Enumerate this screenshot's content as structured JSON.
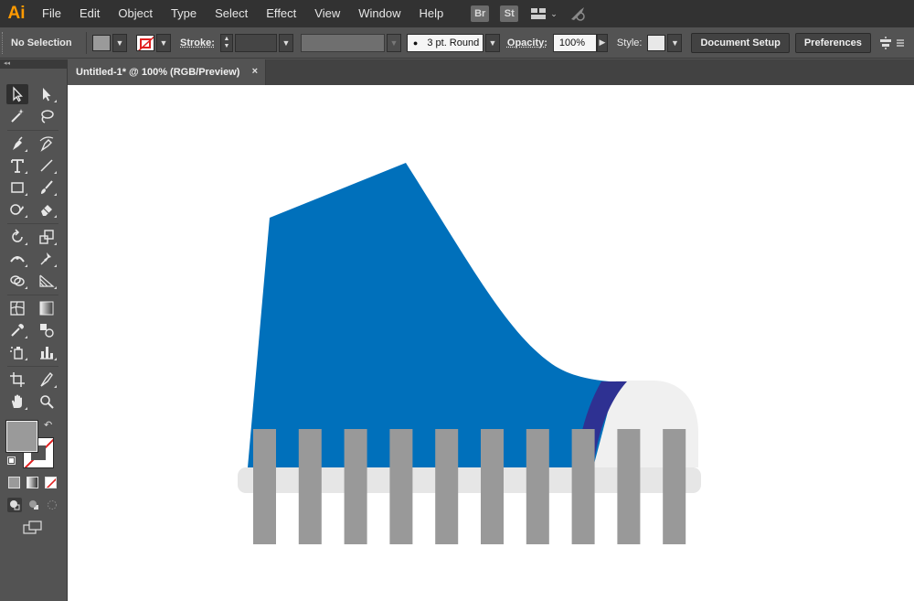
{
  "app": {
    "logo": "Ai",
    "accent": "#ff9a00"
  },
  "menu": [
    "File",
    "Edit",
    "Object",
    "Type",
    "Select",
    "Effect",
    "View",
    "Window",
    "Help"
  ],
  "app_badges": {
    "bridge": "Br",
    "stock": "St"
  },
  "control_bar": {
    "selection_label": "No Selection",
    "fill_color": "#9a9a9a",
    "stroke_label": "Stroke:",
    "brush_value": "3 pt. Round",
    "opacity_label": "Opacity:",
    "opacity_value": "100%",
    "style_label": "Style:",
    "document_setup": "Document Setup",
    "preferences": "Preferences"
  },
  "document_tab": {
    "title": "Untitled-1* @ 100% (RGB/Preview)",
    "close_glyph": "×"
  },
  "tools_panel": {
    "collapse_glyph": "◂◂",
    "fill_swatch": "#9a9a9a",
    "tools": [
      "selection-tool",
      "direct-selection-tool",
      "magic-wand-tool",
      "lasso-tool",
      "pen-tool",
      "curvature-tool",
      "type-tool",
      "line-segment-tool",
      "rectangle-tool",
      "paintbrush-tool",
      "shaper-tool",
      "eraser-tool",
      "rotate-tool",
      "scale-tool",
      "width-tool",
      "puppet-warp-tool",
      "shape-builder-tool",
      "perspective-grid-tool",
      "mesh-tool",
      "gradient-tool",
      "eyedropper-tool",
      "blend-tool",
      "symbol-sprayer-tool",
      "column-graph-tool",
      "artboard-tool",
      "slice-tool",
      "hand-tool",
      "zoom-tool"
    ]
  },
  "artwork": {
    "shoe_body_color": "#0070bb",
    "stripe_color": "#2e3192",
    "toe_cap_color": "#f0f0f0",
    "sole_color": "#e6e6e6",
    "slat_color": "#999999",
    "slat_count": 10
  }
}
